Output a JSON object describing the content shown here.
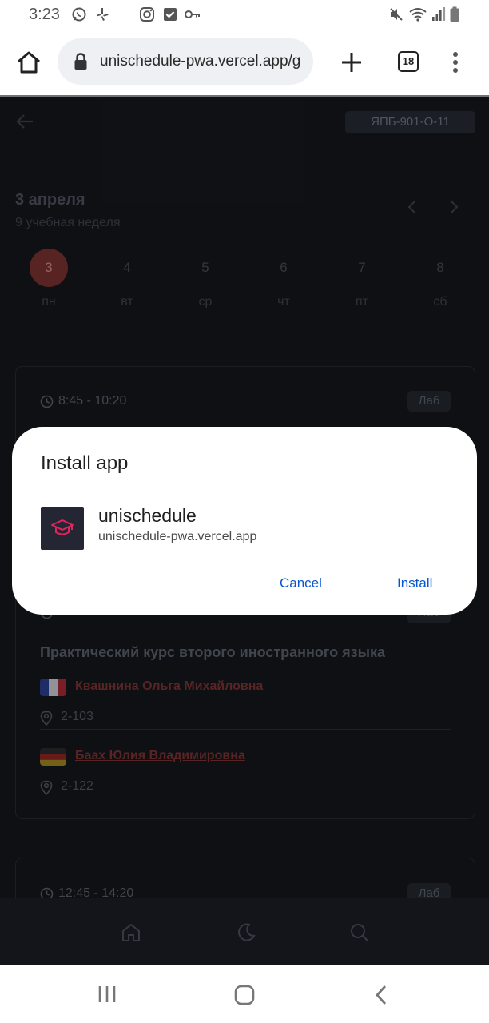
{
  "status_bar": {
    "time": "3:23",
    "left_icons": [
      "whatsapp-icon",
      "yelp-icon",
      "instagram-icon",
      "tasks-check-icon",
      "key-icon"
    ],
    "right_icons": [
      "mute-icon",
      "wifi-icon",
      "signal-icon",
      "battery-icon"
    ]
  },
  "browser": {
    "url": "unischedule-pwa.vercel.app/g",
    "tab_count": "18"
  },
  "page": {
    "group": "ЯПБ-901-О-11",
    "date_title": "3 апреля",
    "week_label": "9 учебная неделя",
    "days": [
      {
        "num": "3",
        "name": "пн",
        "active": true
      },
      {
        "num": "4",
        "name": "вт"
      },
      {
        "num": "5",
        "name": "ср"
      },
      {
        "num": "6",
        "name": "чт"
      },
      {
        "num": "7",
        "name": "пт"
      },
      {
        "num": "8",
        "name": "сб"
      }
    ],
    "lessons": [
      {
        "time": "8:45 - 10:20",
        "type": "Лаб"
      },
      {
        "time": "10:30 - 12:05",
        "type": "Лаб",
        "subject": "Практический курс второго иностранного языка",
        "teachers": [
          {
            "name": "Квашнина Ольга Михайловна",
            "room": "2-103",
            "flag": "france"
          },
          {
            "name": "Баах Юлия Владимировна",
            "room": "2-122",
            "flag": "germany"
          }
        ]
      },
      {
        "time": "12:45 - 14:20",
        "type": "Лаб"
      }
    ],
    "nav_icons": [
      "home-icon",
      "moon-icon",
      "search-icon"
    ]
  },
  "dialog": {
    "title": "Install app",
    "app_name": "unischedule",
    "app_url": "unischedule-pwa.vercel.app",
    "cancel": "Cancel",
    "install": "Install"
  },
  "colors": {
    "accent_blue": "#0b57d0",
    "page_bg": "#15171c",
    "active_day": "#7a3131",
    "link_red": "#7b3333",
    "app_icon_pink": "#e0245e"
  }
}
